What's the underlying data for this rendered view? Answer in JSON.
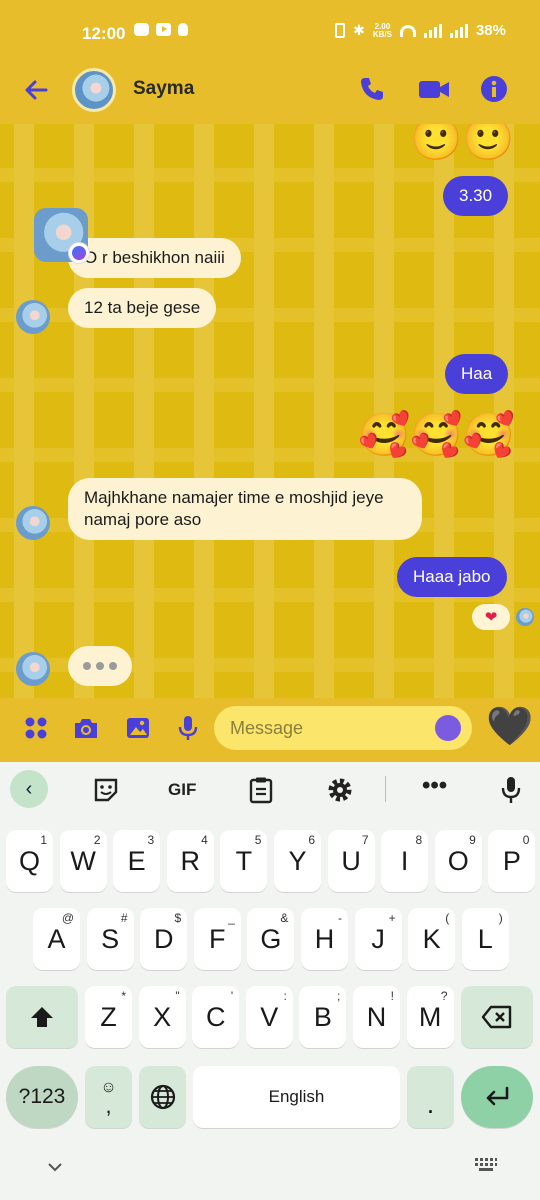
{
  "status_bar": {
    "time": "12:00",
    "speed_value": "2.00",
    "speed_unit": "KB/S",
    "battery": "38%"
  },
  "header": {
    "contact_name": "Sayma"
  },
  "messages": [
    {
      "dir": "in",
      "text": "O r beshikhon naiii"
    },
    {
      "dir": "in",
      "text": "12 ta beje gese"
    },
    {
      "dir": "out",
      "text": "3.30"
    },
    {
      "dir": "out",
      "text": "Haa"
    },
    {
      "dir": "in",
      "text": "Majhkhane namajer time e moshjid jeye namaj pore aso"
    },
    {
      "dir": "out",
      "text": "Haaa jabo"
    }
  ],
  "emoji_rows": {
    "smiles": "🙂🙂",
    "love": "🥰🥰🥰"
  },
  "reaction": "❤",
  "composer": {
    "placeholder": "Message",
    "heart": "🖤"
  },
  "keyboard": {
    "toolbar": {
      "gif": "GIF"
    },
    "row1": [
      {
        "k": "Q",
        "h": "1"
      },
      {
        "k": "W",
        "h": "2"
      },
      {
        "k": "E",
        "h": "3"
      },
      {
        "k": "R",
        "h": "4"
      },
      {
        "k": "T",
        "h": "5"
      },
      {
        "k": "Y",
        "h": "6"
      },
      {
        "k": "U",
        "h": "7"
      },
      {
        "k": "I",
        "h": "8"
      },
      {
        "k": "O",
        "h": "9"
      },
      {
        "k": "P",
        "h": "0"
      }
    ],
    "row2": [
      {
        "k": "A",
        "h": "@"
      },
      {
        "k": "S",
        "h": "#"
      },
      {
        "k": "D",
        "h": "$"
      },
      {
        "k": "F",
        "h": "_"
      },
      {
        "k": "G",
        "h": "&"
      },
      {
        "k": "H",
        "h": "-"
      },
      {
        "k": "J",
        "h": "+"
      },
      {
        "k": "K",
        "h": "("
      },
      {
        "k": "L",
        "h": ")"
      }
    ],
    "row3": [
      {
        "k": "Z",
        "h": "*"
      },
      {
        "k": "X",
        "h": "\""
      },
      {
        "k": "C",
        "h": "'"
      },
      {
        "k": "V",
        "h": ":"
      },
      {
        "k": "B",
        "h": ";"
      },
      {
        "k": "N",
        "h": "!"
      },
      {
        "k": "M",
        "h": "?"
      }
    ],
    "num_label": "?123",
    "comma": ",",
    "space_label": "English",
    "period": "."
  }
}
